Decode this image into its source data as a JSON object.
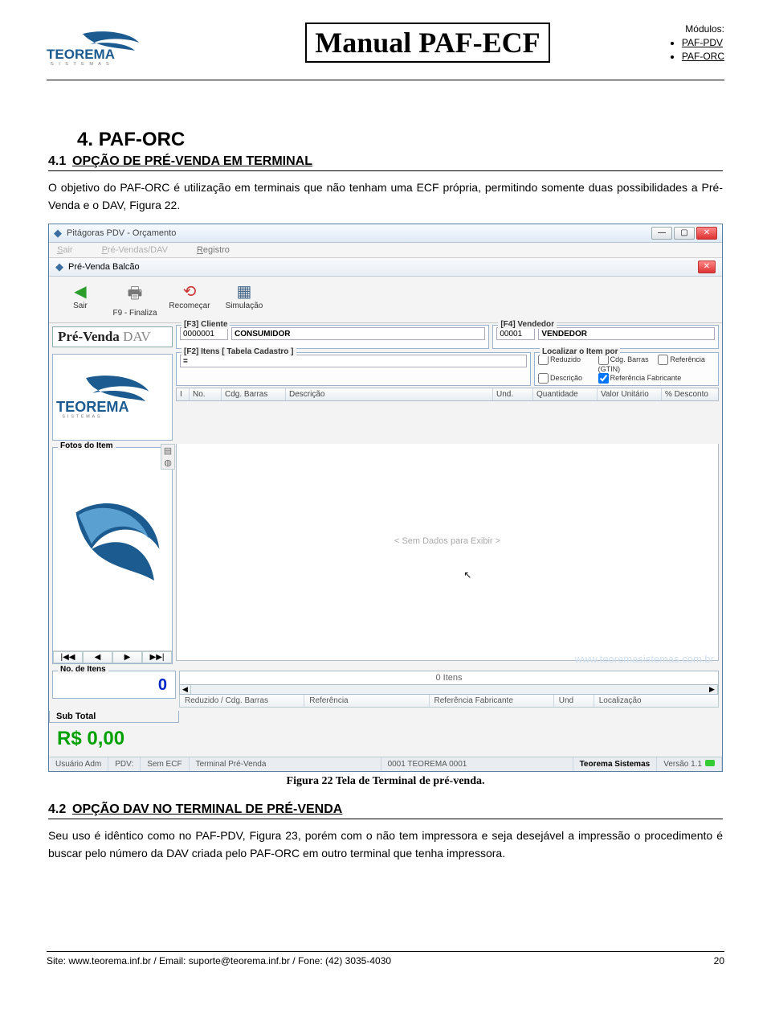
{
  "header": {
    "manual_title": "Manual PAF-ECF",
    "logo_brand": "TEOREMA",
    "logo_sub": "S I S T E M A S",
    "modules_label": "Módulos:",
    "modules": [
      "PAF-PDV",
      "PAF-ORC"
    ]
  },
  "section4": {
    "num": "4.",
    "title": "PAF-ORC",
    "sub41_num": "4.1",
    "sub41_title": "OPÇÃO DE PRÉ-VENDA EM TERMINAL",
    "sub41_body": "O objetivo do PAF-ORC é utilização em terminais que não tenham uma ECF própria, permitindo somente duas possibilidades a Pré-Venda e o DAV, Figura 22.",
    "sub42_num": "4.2",
    "sub42_title": "OPÇÃO DAV NO TERMINAL DE PRÉ-VENDA",
    "sub42_body": "Seu uso é idêntico como no PAF-PDV, Figura 23, porém com o não tem impressora e seja desejável a impressão o procedimento é buscar pelo número da DAV criada pelo PAF-ORC em outro terminal que tenha impressora."
  },
  "figure": {
    "caption": "Figura 22 Tela de Terminal de pré-venda."
  },
  "screenshot": {
    "window_title": "Pitágoras PDV - Orçamento",
    "menu": {
      "sair": "Sair",
      "prevendas": "Pré-Vendas/DAV",
      "registro": "Registro"
    },
    "pvb_title": "Pré-Venda Balcão",
    "toolbar": {
      "sair": "Sair",
      "finaliza": "F9 - Finaliza",
      "recomecar": "Recomeçar",
      "simulacao": "Simulação"
    },
    "pv_label_main": "Pré-Venda",
    "pv_label_light": "DAV",
    "cliente_legend": "[F3] Cliente",
    "cliente_codigo": "0000001",
    "cliente_nome": "CONSUMIDOR",
    "vendedor_legend": "[F4] Vendedor",
    "vendedor_codigo": "00001",
    "vendedor_nome": "VENDEDOR",
    "itens_legend": "[F2] Itens [ Tabela Cadastro ]",
    "locate_legend": "Localizar o Item por",
    "locate_options": {
      "reduzido": "Reduzido",
      "cdg_barras": "Cdg. Barras (GTIN)",
      "referencia": "Referência",
      "descricao": "Descrição",
      "ref_fab": "Referência Fabricante"
    },
    "grid_cols": {
      "i": "I",
      "no": "No.",
      "cdg": "Cdg. Barras",
      "desc": "Descrição",
      "und": "Und.",
      "qtd": "Quantidade",
      "valor": "Valor Unitário",
      "desconto": "% Desconto"
    },
    "fotos_legend": "Fotos do Item",
    "no_data": "< Sem Dados para Exibir >",
    "noitens_legend": "No. de Itens",
    "noitens_val": "0",
    "subtotal_label": "Sub Total",
    "zero_itens": "0 Itens",
    "subtotal_value": "R$ 0,00",
    "ghost_link": "www.teoremasistemas.com.br",
    "bottom_cols": {
      "reduzido": "Reduzido / Cdg. Barras",
      "ref": "Referência",
      "reffab": "Referência Fabricante",
      "und": "Und",
      "loc": "Localização"
    },
    "status": {
      "usuario": "Usuário Adm",
      "pdv": "PDV:",
      "semecf": "Sem ECF",
      "terminal": "Terminal Pré-Venda",
      "codigo": "0001 TEOREMA 0001",
      "empresa": "Teorema Sistemas",
      "versao": "Versão 1.1"
    }
  },
  "footer": {
    "text": "Site: www.teorema.inf.br / Email: suporte@teorema.inf.br / Fone: (42) 3035-4030",
    "page": "20"
  }
}
